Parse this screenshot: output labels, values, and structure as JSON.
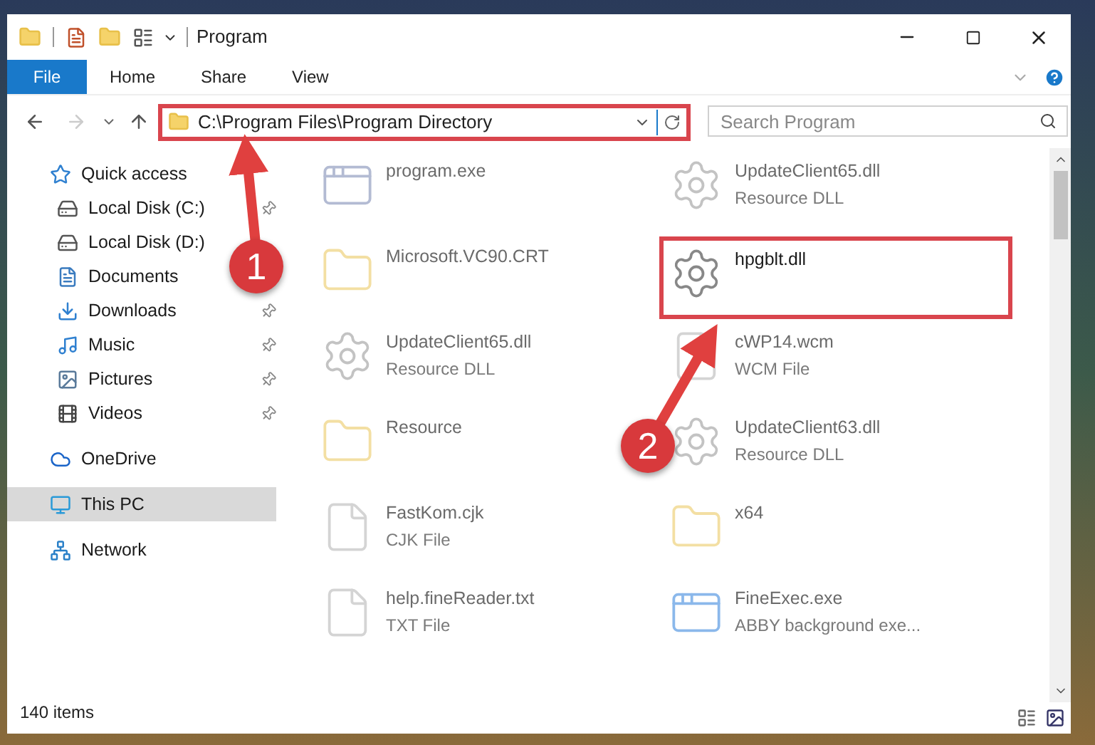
{
  "window": {
    "title": "Program"
  },
  "ribbon_tabs": [
    {
      "label": "File",
      "kind": "file"
    },
    {
      "label": "Home",
      "kind": "tab"
    },
    {
      "label": "Share",
      "kind": "tab"
    },
    {
      "label": "View",
      "kind": "tab"
    }
  ],
  "address": {
    "path": "C:\\Program Files\\Program Directory",
    "highlighted": true
  },
  "search": {
    "placeholder": "Search Program"
  },
  "sidebar": {
    "items": [
      {
        "label": "Quick access",
        "kind": "quick",
        "selected": false,
        "children": [
          {
            "label": "Local Disk (C:)",
            "kind": "disk",
            "pinned": true
          },
          {
            "label": "Local Disk (D:)",
            "kind": "disk",
            "pinned": false
          },
          {
            "label": "Documents",
            "kind": "documents",
            "pinned": false
          },
          {
            "label": "Downloads",
            "kind": "downloads",
            "pinned": true
          },
          {
            "label": "Music",
            "kind": "music",
            "pinned": true
          },
          {
            "label": "Pictures",
            "kind": "pictures",
            "pinned": true
          },
          {
            "label": "Videos",
            "kind": "videos",
            "pinned": true
          }
        ]
      },
      {
        "label": "OneDrive",
        "kind": "cloud",
        "selected": false
      },
      {
        "label": "This PC",
        "kind": "pc",
        "selected": true
      },
      {
        "label": "Network",
        "kind": "network",
        "selected": false
      }
    ]
  },
  "files": [
    {
      "name": "program.exe",
      "kind": "exe",
      "blurred": true,
      "highlighted": false
    },
    {
      "name": "UpdateClient65.dll",
      "type": "Resource DLL",
      "kind": "dll",
      "blurred": true,
      "highlighted": false
    },
    {
      "name": "Microsoft.VC90.CRT",
      "kind": "folder",
      "blurred": true,
      "highlighted": false
    },
    {
      "name": "hpgblt.dll",
      "kind": "dll",
      "blurred": false,
      "highlighted": true
    },
    {
      "name": "UpdateClient65.dll",
      "type": "Resource DLL",
      "kind": "dll",
      "blurred": true,
      "highlighted": false
    },
    {
      "name": "cWP14.wcm",
      "type": "WCM File",
      "kind": "file",
      "blurred": true,
      "highlighted": false
    },
    {
      "name": "Resource",
      "kind": "folder",
      "blurred": true,
      "highlighted": false
    },
    {
      "name": "UpdateClient63.dll",
      "type": "Resource DLL",
      "kind": "dll",
      "blurred": true,
      "highlighted": false
    },
    {
      "name": "FastKom.cjk",
      "type": "CJK File",
      "kind": "file",
      "blurred": true,
      "highlighted": false
    },
    {
      "name": "x64",
      "kind": "folder",
      "blurred": true,
      "highlighted": false
    },
    {
      "name": "help.fineReader.txt",
      "type": "TXT File",
      "kind": "file",
      "blurred": true,
      "highlighted": false
    },
    {
      "name": "FineExec.exe",
      "type": "ABBY background exe...",
      "kind": "app",
      "blurred": true,
      "highlighted": false
    }
  ],
  "status_bar": {
    "count": "140 items"
  },
  "annotations": [
    {
      "number": "1"
    },
    {
      "number": "2"
    }
  ]
}
